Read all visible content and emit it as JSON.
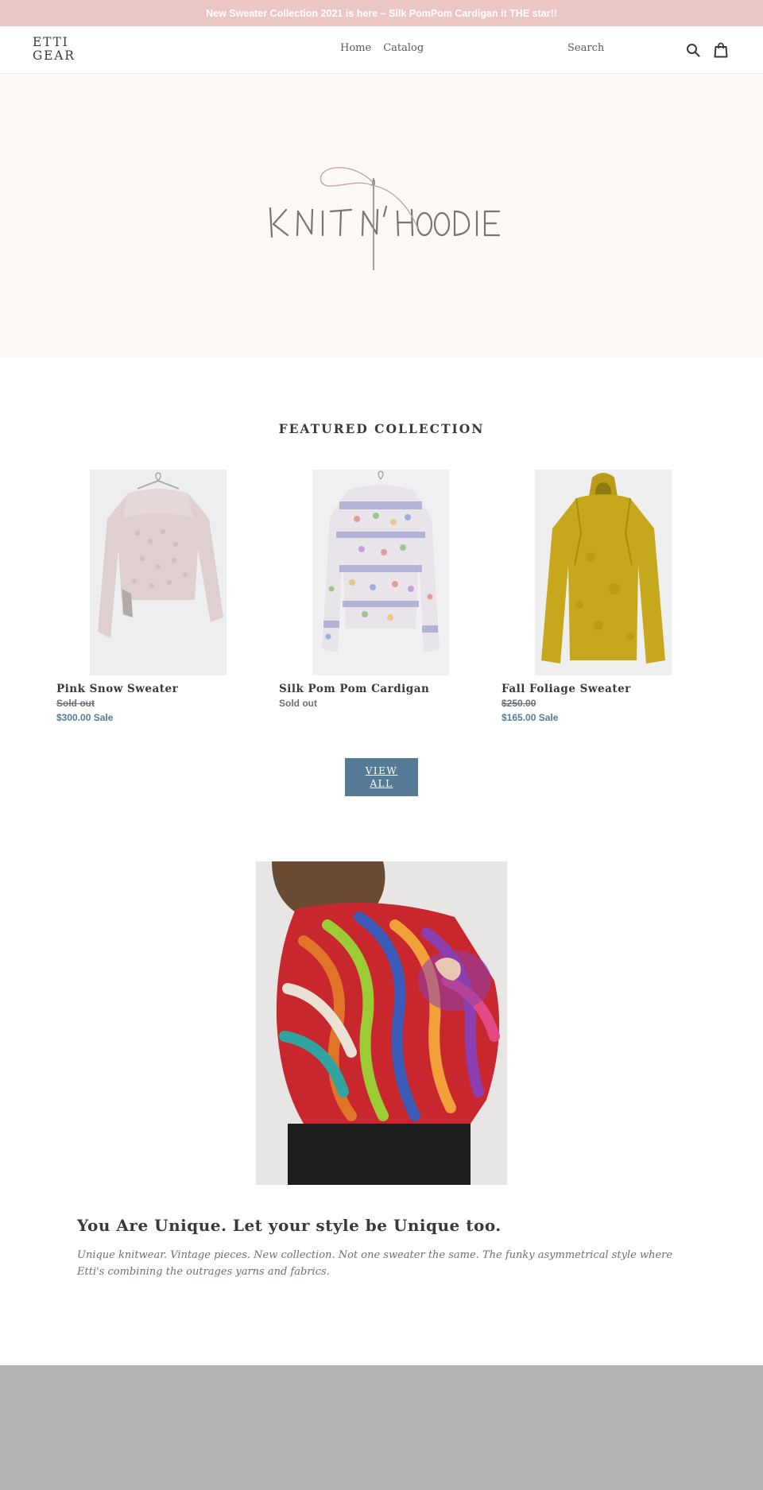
{
  "announcement": {
    "text": "New Sweater Collection 2021 is here – Silk PomPom Cardigan it THE star!!"
  },
  "header": {
    "logo": "ETTI GEAR",
    "nav": [
      {
        "label": "Home"
      },
      {
        "label": "Catalog"
      }
    ],
    "search_label": "Search",
    "icons": [
      "search-icon",
      "cart-icon"
    ]
  },
  "hero": {
    "logo_text": "KNIT N' HOODIE"
  },
  "featured": {
    "title": "FEATURED COLLECTION",
    "products": [
      {
        "name": "Pink Snow Sweater",
        "line1": "Sold out",
        "line2": "$300.00 Sale",
        "line1_strike": true
      },
      {
        "name": "Silk Pom Pom Cardigan",
        "line1": "Sold out",
        "line2": "",
        "line1_strike": false
      },
      {
        "name": "Fall Foliage Sweater",
        "line1": "$250.00",
        "line2": "$165.00 Sale",
        "line1_strike": true
      }
    ],
    "view_all": "VIEW ALL"
  },
  "feature": {
    "heading": "You Are Unique. Let your style be Unique too.",
    "text": "Unique knitwear. Vintage pieces. New collection. Not one sweater the same. The funky asymmetrical style where Etti's combining the outrages yarns and fabrics."
  },
  "colors": {
    "announcement_bg": "#ecc5c6",
    "accent": "#557b97",
    "hero_bg": "#fdf9f4",
    "footer_bg": "#b2b3b5"
  }
}
